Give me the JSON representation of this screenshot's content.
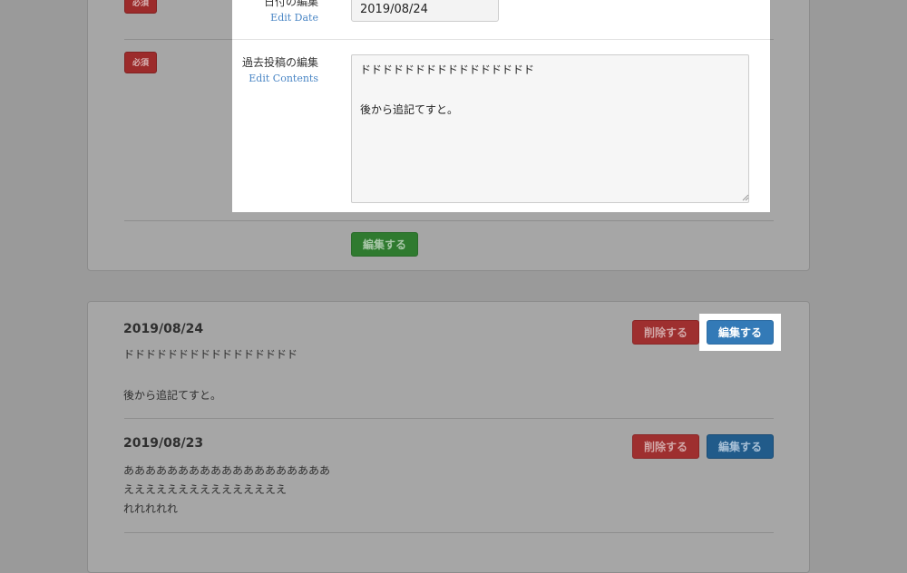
{
  "top_card": {
    "required_badge_1": "必須",
    "required_badge_2": "必須",
    "submit_label": "編集する"
  },
  "modal": {
    "date_label": "日付の編集",
    "date_sublabel": "Edit Date",
    "date_value": "2019/08/24",
    "content_label": "過去投稿の編集",
    "content_sublabel": "Edit Contents",
    "content_value": "ドドドドドドドドドドドドドドドド\n\n後から追記てすと。"
  },
  "posts": [
    {
      "date": "2019/08/24",
      "lines": [
        "ドドドドドドドドドドドドドドドド",
        "",
        "後から追記てすと。"
      ],
      "delete_label": "削除する",
      "edit_label": "編集する"
    },
    {
      "date": "2019/08/23",
      "lines": [
        "あああああああああああああああああああ",
        "えええええええええええええええ",
        "れれれれれ"
      ],
      "delete_label": "削除する",
      "edit_label": "編集する"
    }
  ],
  "colors": {
    "overlay": "#9a9a9a",
    "primary_blue": "#337ab7",
    "danger_red": "#9e2f2f",
    "success_green": "#2f7a2f",
    "sublabel_blue": "#4a86c5"
  }
}
